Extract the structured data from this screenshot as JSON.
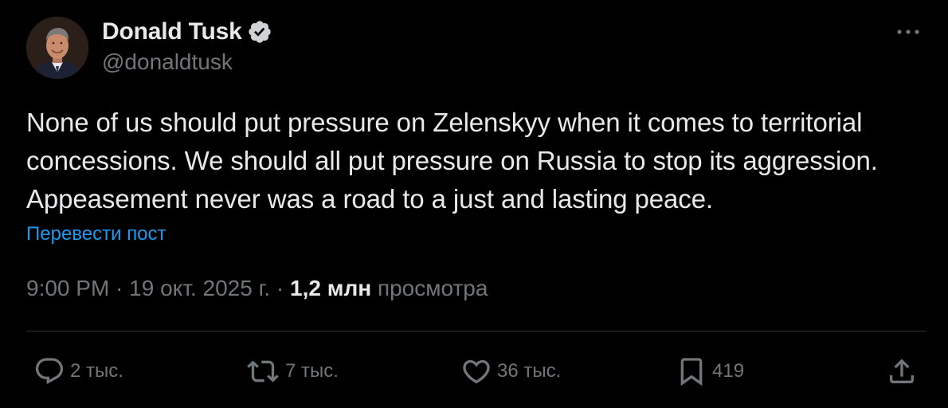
{
  "author": {
    "display_name": "Donald Tusk",
    "handle": "@donaldtusk",
    "verified": true
  },
  "tweet": {
    "text": "None of us should put pressure on Zelenskyy when it comes to territorial concessions. We should all put pressure on Russia to stop its aggression. Appeasement never was a road to a just and lasting peace.",
    "translate_label": "Перевести пост"
  },
  "meta": {
    "time": "9:00 PM",
    "separator": " · ",
    "date": "19 окт. 2025 г.",
    "separator2": " · ",
    "views_count": "1,2 млн",
    "views_label": " просмотра"
  },
  "actions": {
    "replies": "2 тыс.",
    "retweets": "7 тыс.",
    "likes": "36 тыс.",
    "bookmarks": "419"
  },
  "icons": {
    "verified": "verified-badge-icon",
    "more": "more-icon",
    "reply": "reply-icon",
    "retweet": "retweet-icon",
    "like": "heart-icon",
    "bookmark": "bookmark-icon",
    "share": "share-icon"
  },
  "colors": {
    "background": "#000000",
    "text_primary": "#e7e9ea",
    "text_secondary": "#71767b",
    "link": "#1d9bf0",
    "divider": "#2f3336"
  }
}
